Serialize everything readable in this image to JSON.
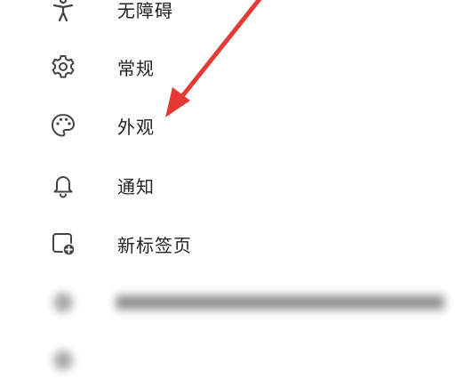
{
  "menu": {
    "items": [
      {
        "label": "无障碍",
        "icon": "accessibility-icon"
      },
      {
        "label": "常规",
        "icon": "gear-icon"
      },
      {
        "label": "外观",
        "icon": "palette-icon"
      },
      {
        "label": "通知",
        "icon": "bell-icon"
      },
      {
        "label": "新标签页",
        "icon": "new-tab-icon"
      }
    ]
  },
  "colors": {
    "text": "#222222",
    "icon": "#444444",
    "arrow": "#e53935"
  }
}
